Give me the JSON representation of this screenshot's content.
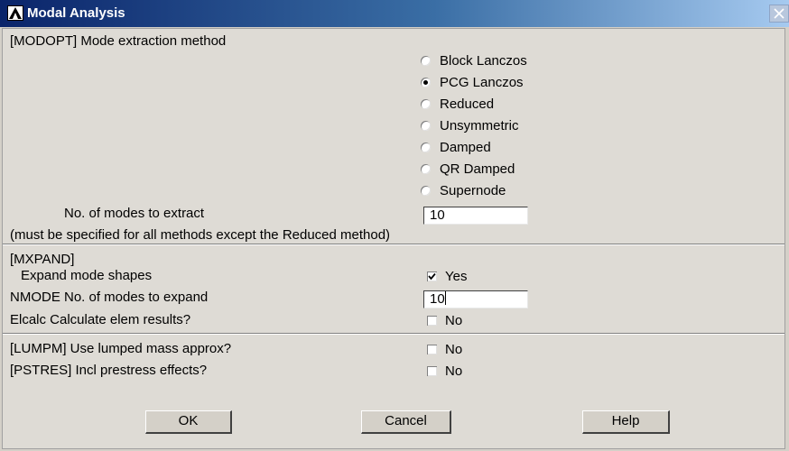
{
  "window": {
    "title": "Modal Analysis",
    "logo_icon": "ansys-logo-icon",
    "close_icon": "close-icon"
  },
  "modopt": {
    "header": "[MODOPT] Mode extraction method",
    "methods": [
      {
        "label": "Block Lanczos",
        "selected": false
      },
      {
        "label": "PCG Lanczos",
        "selected": true
      },
      {
        "label": "Reduced",
        "selected": false
      },
      {
        "label": "Unsymmetric",
        "selected": false
      },
      {
        "label": "Damped",
        "selected": false
      },
      {
        "label": "QR Damped",
        "selected": false
      },
      {
        "label": "Supernode",
        "selected": false
      }
    ],
    "num_modes_label": "No. of modes to extract",
    "num_modes_value": "10",
    "note": "(must be specified for all methods except the Reduced method)"
  },
  "mxpand": {
    "header": "[MXPAND]",
    "expand_label": "Expand mode shapes",
    "expand_checked": true,
    "expand_value": "Yes",
    "nmode_label": "NMODE No. of modes to expand",
    "nmode_value": "10",
    "elcalc_label": "Elcalc  Calculate elem results?",
    "elcalc_checked": false,
    "elcalc_value": "No"
  },
  "misc": {
    "lumpm_label": "[LUMPM]  Use lumped mass approx?",
    "lumpm_checked": false,
    "lumpm_value": "No",
    "pstres_label": "[PSTRES] Incl prestress effects?",
    "pstres_checked": false,
    "pstres_value": "No"
  },
  "buttons": {
    "ok": "OK",
    "cancel": "Cancel",
    "help": "Help"
  },
  "colors": {
    "titlebar_start": "#0a246a",
    "titlebar_end": "#a6caf0",
    "dialog_bg": "#dedbd5"
  }
}
